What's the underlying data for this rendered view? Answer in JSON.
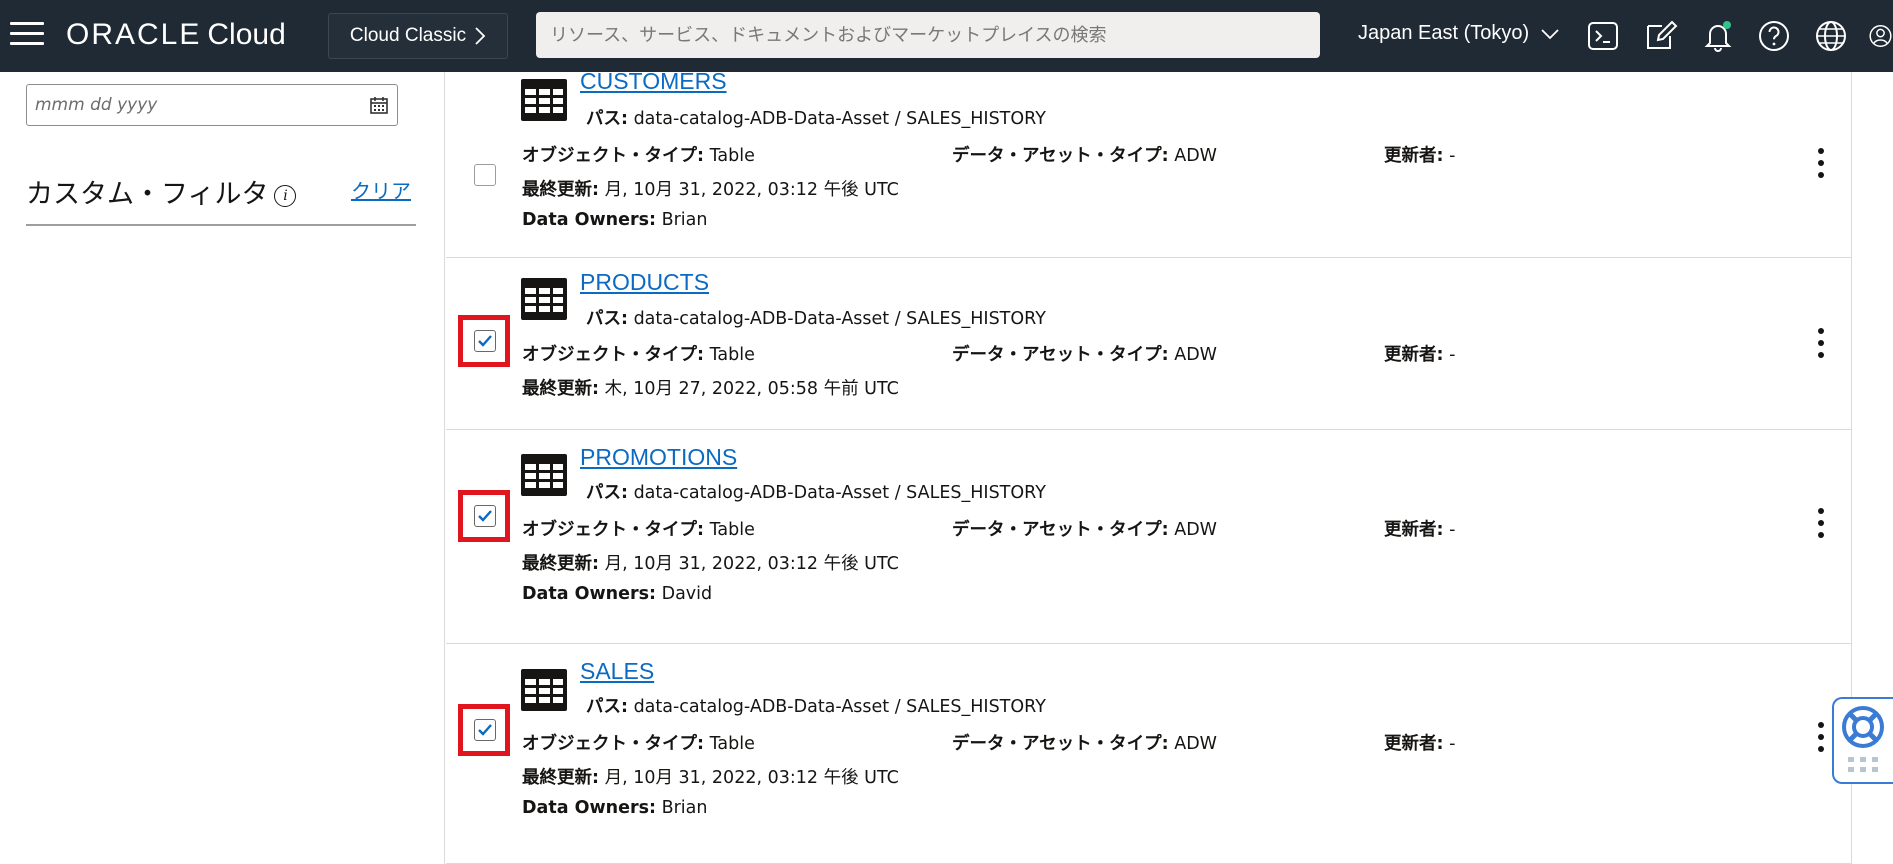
{
  "header": {
    "logo_oracle": "ORACLE",
    "logo_cloud": "Cloud",
    "classic_label": "Cloud Classic",
    "search_placeholder": "リソース、サービス、ドキュメントおよびマーケットプレイスの検索",
    "region": "Japan East (Tokyo)",
    "icons": [
      "menu-icon",
      "chevron-right-icon",
      "chevron-down-icon",
      "cloud-shell-icon",
      "edit-icon",
      "bell-icon",
      "help-icon",
      "globe-icon",
      "avatar-icon"
    ],
    "notification_dot_color": "#2fc48d"
  },
  "left": {
    "date_placeholder": "mmm dd yyyy",
    "custom_filter_label": "カスタム・フィルタ",
    "info_glyph": "i",
    "clear_label": "クリア"
  },
  "labels": {
    "path": "パス:",
    "object_type": "オブジェクト・タイプ:",
    "data_asset_type": "データ・アセット・タイプ:",
    "updated_by": "更新者:",
    "last_updated": "最終更新:",
    "data_owners": "Data Owners:"
  },
  "items": [
    {
      "title": "CUSTOMERS",
      "path": "data-catalog-ADB-Data-Asset / SALES_HISTORY",
      "object_type": "Table",
      "data_asset_type": "ADW",
      "updated_by": "-",
      "last_updated": "月, 10月 31, 2022, 03:12 午後 UTC",
      "data_owners": "Brian",
      "checked": false
    },
    {
      "title": "PRODUCTS",
      "path": "data-catalog-ADB-Data-Asset / SALES_HISTORY",
      "object_type": "Table",
      "data_asset_type": "ADW",
      "updated_by": "-",
      "last_updated": "木, 10月 27, 2022, 05:58 午前 UTC",
      "checked": true
    },
    {
      "title": "PROMOTIONS",
      "path": "data-catalog-ADB-Data-Asset / SALES_HISTORY",
      "object_type": "Table",
      "data_asset_type": "ADW",
      "updated_by": "-",
      "last_updated": "月, 10月 31, 2022, 03:12 午後 UTC",
      "data_owners": "David",
      "checked": true
    },
    {
      "title": "SALES",
      "path": "data-catalog-ADB-Data-Asset / SALES_HISTORY",
      "object_type": "Table",
      "data_asset_type": "ADW",
      "updated_by": "-",
      "last_updated": "月, 10月 31, 2022, 03:12 午後 UTC",
      "data_owners": "Brian",
      "checked": true
    }
  ],
  "colors": {
    "header_bg": "#1f2a34",
    "link": "#0b6ac2",
    "highlight": "#e0161e",
    "check": "#0b6ac2",
    "help_widget": "#3a7bd5"
  }
}
